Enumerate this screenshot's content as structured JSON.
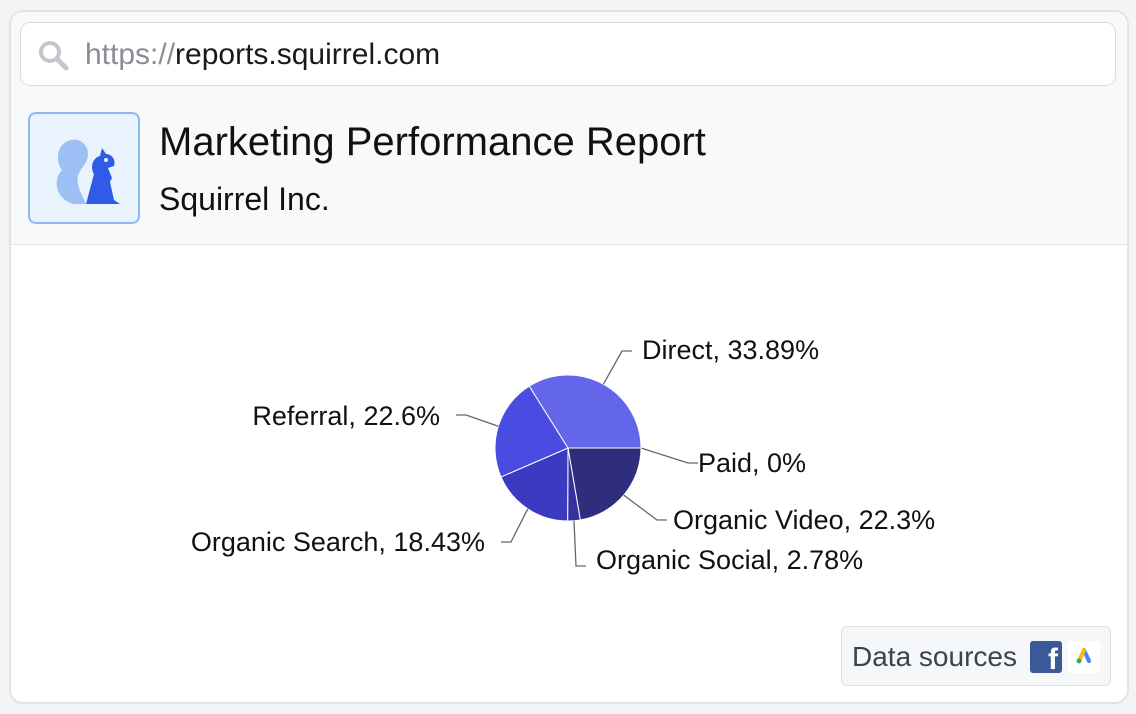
{
  "url": {
    "protocol": "https://",
    "host": "reports.squirrel.com"
  },
  "header": {
    "title": "Marketing Performance Report",
    "company": "Squirrel Inc.",
    "logo_icon": "squirrel-icon"
  },
  "footer": {
    "sources_label": "Data sources",
    "source_icons": [
      "facebook-icon",
      "google-ads-icon"
    ]
  },
  "colors": {
    "accent": "#2f5be6",
    "logo_background": "#e8f3fd",
    "facebook": "#3b5998"
  },
  "chart_data": {
    "type": "pie",
    "title": "",
    "slices": [
      {
        "label": "Paid",
        "value": 0,
        "display": "Paid, 0%",
        "color": "#2f2e7e"
      },
      {
        "label": "Organic Video",
        "value": 22.3,
        "display": "Organic Video, 22.3%",
        "color": "#2f2e7e"
      },
      {
        "label": "Organic Social",
        "value": 2.78,
        "display": "Organic Social, 2.78%",
        "color": "#35319e"
      },
      {
        "label": "Organic Search",
        "value": 18.43,
        "display": "Organic Search, 18.43%",
        "color": "#3c3ac0"
      },
      {
        "label": "Referral",
        "value": 22.6,
        "display": "Referral, 22.6%",
        "color": "#4a4be0"
      },
      {
        "label": "Direct",
        "value": 33.89,
        "display": "Direct, 33.89%",
        "color": "#6366e8"
      }
    ],
    "legend": "none"
  }
}
